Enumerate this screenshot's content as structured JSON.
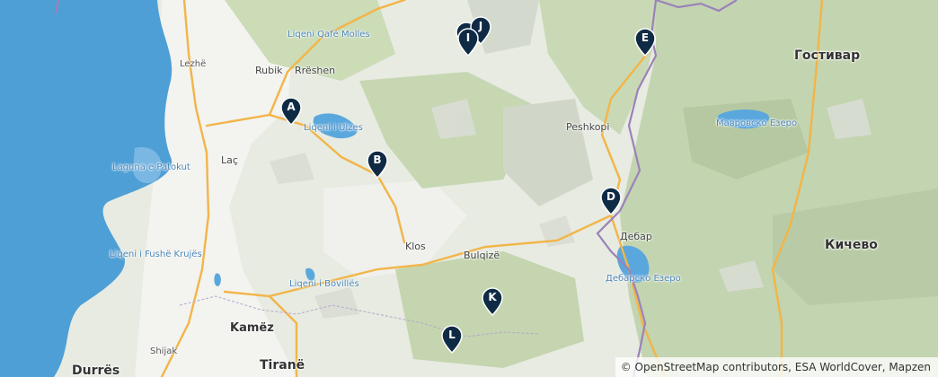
{
  "map": {
    "places": {
      "lezhe": "Lezhë",
      "rubik": "Rubik",
      "rreshen": "Rrëshen",
      "liqeni_mollas": "Liqeni Qafë Molles",
      "liqeni_ulzes": "Liqeni i Ulzes",
      "laguna_patokut": "Laguna e Patokut",
      "lac": "Laç",
      "peshkopi": "Peshkopi",
      "gostivar": "Гостивар",
      "mavrovsko": "Мавровско Езеро",
      "debar": "Дебар",
      "debarsko": "Дебарско Езеро",
      "kichevo": "Кичево",
      "klos": "Klos",
      "bulqize": "Bulqizë",
      "liqeni_fushe_krujes": "Liqeni i Fushë Krujës",
      "liqeni_bovilles": "Liqeni i Bovillës",
      "kamez": "Kamëz",
      "shijak": "Shijak",
      "durres": "Durrës",
      "tirane": "Tiranë"
    },
    "markers": [
      {
        "id": "A",
        "label": "A"
      },
      {
        "id": "B",
        "label": "B"
      },
      {
        "id": "D",
        "label": "D"
      },
      {
        "id": "E",
        "label": "E"
      },
      {
        "id": "I",
        "label": "I"
      },
      {
        "id": "J",
        "label": "J"
      },
      {
        "id": "K",
        "label": "K"
      },
      {
        "id": "L",
        "label": "L"
      }
    ],
    "attribution": "© OpenStreetMap contributors, ESA WorldCover, Mapzen",
    "colors": {
      "sea": "#4e9fd6",
      "land": "#e9ece4",
      "lowland": "#f2f2ee",
      "forest": "#c9d8b5",
      "hills": "#b7c9a4",
      "road": "#f2b548",
      "border": "#9b82b8",
      "marker": "#0f2a44"
    }
  }
}
